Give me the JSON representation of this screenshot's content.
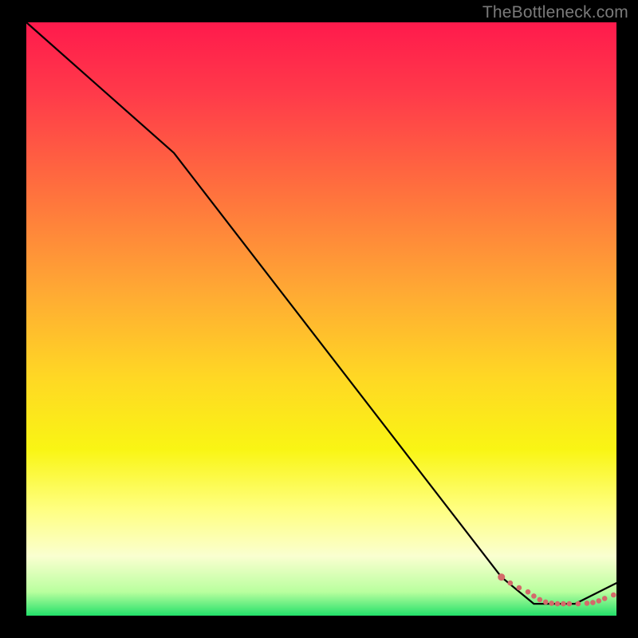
{
  "watermark": "TheBottleneck.com",
  "chart_data": {
    "type": "line",
    "title": "",
    "xlabel": "",
    "ylabel": "",
    "xlim": [
      0,
      100
    ],
    "ylim": [
      0,
      100
    ],
    "grid": false,
    "legend": false,
    "series": [
      {
        "name": "heatmap-background",
        "type": "area",
        "note": "Vertical gradient fill representing bottleneck severity (red=high, green=low)",
        "gradient_stops": [
          {
            "offset": 0.0,
            "color": "#ff1a4c"
          },
          {
            "offset": 0.12,
            "color": "#ff3a4a"
          },
          {
            "offset": 0.28,
            "color": "#ff6f3e"
          },
          {
            "offset": 0.45,
            "color": "#ffa834"
          },
          {
            "offset": 0.6,
            "color": "#ffd824"
          },
          {
            "offset": 0.72,
            "color": "#f9f514"
          },
          {
            "offset": 0.82,
            "color": "#ffff80"
          },
          {
            "offset": 0.9,
            "color": "#faffd0"
          },
          {
            "offset": 0.96,
            "color": "#b9ff9e"
          },
          {
            "offset": 1.0,
            "color": "#23e06a"
          }
        ]
      },
      {
        "name": "bottleneck-curve",
        "type": "line",
        "color": "#000000",
        "x": [
          0.0,
          25.0,
          80.5,
          86.0,
          93.0,
          100.0
        ],
        "y": [
          100.0,
          78.0,
          6.5,
          2.0,
          2.0,
          5.5
        ]
      },
      {
        "name": "marker-cluster",
        "type": "scatter",
        "color": "#d46a6a",
        "x": [
          80.5,
          82.0,
          83.5,
          85.0,
          86.0,
          87.0,
          88.0,
          89.0,
          90.0,
          91.0,
          92.0,
          93.5,
          95.0,
          96.0,
          97.0,
          98.0,
          99.5
        ],
        "y": [
          6.5,
          5.5,
          4.7,
          4.0,
          3.3,
          2.7,
          2.3,
          2.1,
          2.0,
          2.0,
          2.0,
          2.0,
          2.1,
          2.2,
          2.5,
          2.9,
          3.5
        ]
      }
    ]
  }
}
